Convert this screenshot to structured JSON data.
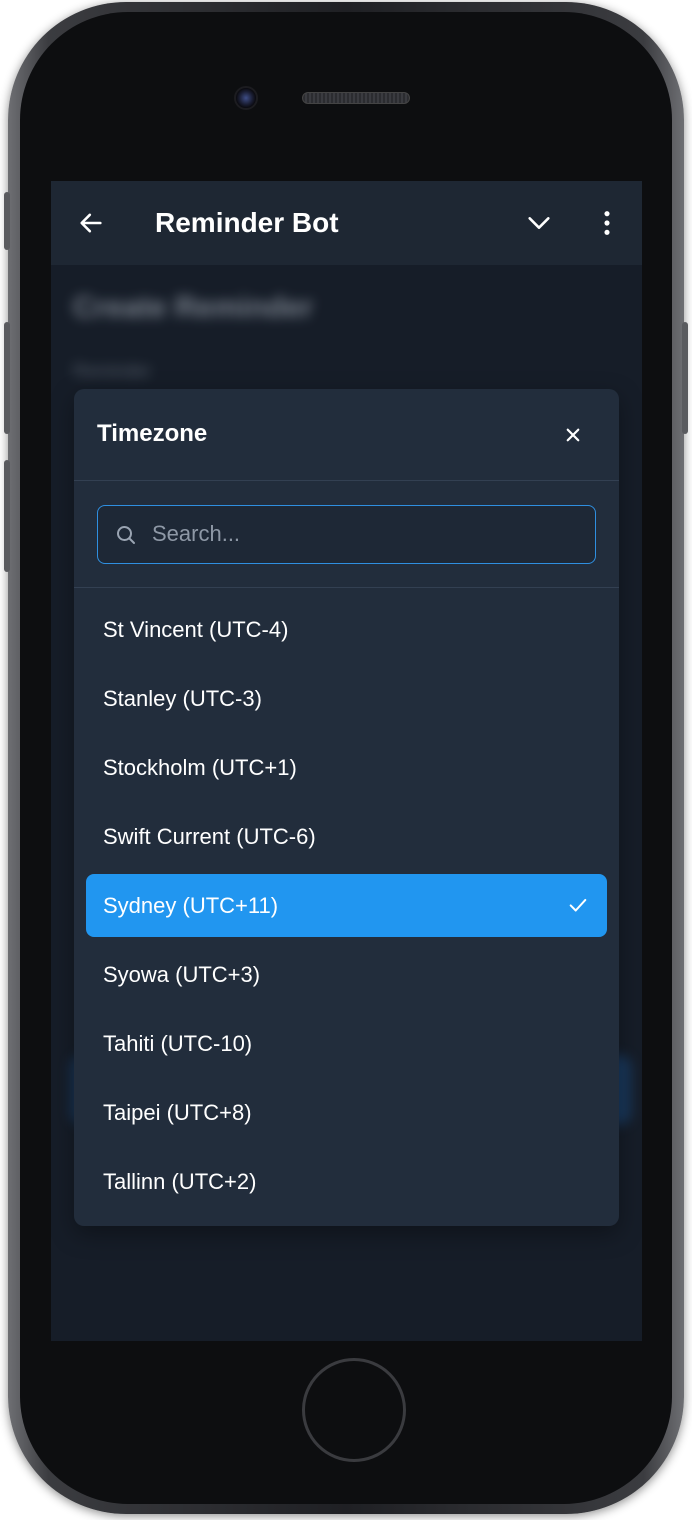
{
  "app_bar": {
    "title": "Reminder Bot",
    "back_icon": "arrow-left-icon",
    "dropdown_icon": "chevron-down-icon",
    "menu_icon": "more-vertical-icon"
  },
  "background": {
    "heading": "Create Reminder",
    "label": "Reminder"
  },
  "timezone_modal": {
    "title": "Timezone",
    "close_icon": "close-icon",
    "search": {
      "placeholder": "Search...",
      "value": ""
    },
    "items": [
      {
        "label": "St Vincent (UTC-4)",
        "selected": false
      },
      {
        "label": "Stanley (UTC-3)",
        "selected": false
      },
      {
        "label": "Stockholm (UTC+1)",
        "selected": false
      },
      {
        "label": "Swift Current (UTC-6)",
        "selected": false
      },
      {
        "label": "Sydney (UTC+11)",
        "selected": true
      },
      {
        "label": "Syowa (UTC+3)",
        "selected": false
      },
      {
        "label": "Tahiti (UTC-10)",
        "selected": false
      },
      {
        "label": "Taipei (UTC+8)",
        "selected": false
      },
      {
        "label": "Tallinn (UTC+2)",
        "selected": false
      }
    ]
  },
  "colors": {
    "accent": "#2196f0",
    "modal_bg": "#222d3c",
    "screen_bg": "#161d28",
    "app_bar_bg": "#1e2733"
  }
}
